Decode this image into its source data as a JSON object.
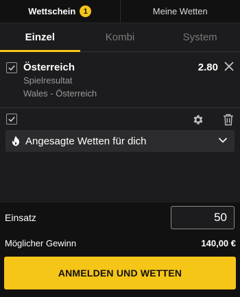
{
  "top_tabs": {
    "betslip_label": "Wettschein",
    "betslip_count": "1",
    "my_bets_label": "Meine Wetten"
  },
  "bet_type_tabs": [
    {
      "label": "Einzel",
      "active": true
    },
    {
      "label": "Kombi",
      "active": false
    },
    {
      "label": "System",
      "active": false
    }
  ],
  "selection": {
    "team": "Österreich",
    "market": "Spielresultat",
    "match": "Wales - Österreich",
    "odds": "2.80"
  },
  "suggested": {
    "label": "Angesagte Wetten für dich"
  },
  "stake": {
    "label": "Einsatz",
    "value": "50"
  },
  "potential_win": {
    "label": "Möglicher Gewinn",
    "value": "140,00 €"
  },
  "cta": {
    "label": "ANMELDEN UND WETTEN"
  },
  "colors": {
    "accent": "#f5c518",
    "background": "#1c1c1e",
    "bar_background": "#111112"
  },
  "icons": [
    "checkbox-icon",
    "close-icon",
    "gear-icon",
    "trash-icon",
    "flame-icon",
    "chevron-down-icon"
  ]
}
